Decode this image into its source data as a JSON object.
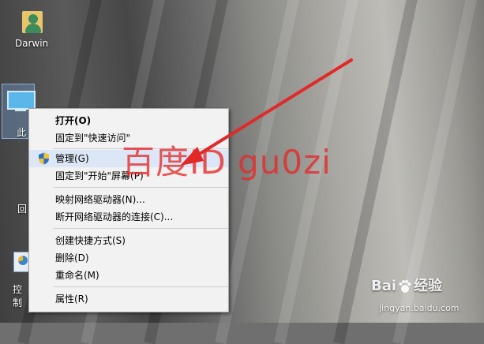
{
  "desktop": {
    "icons": [
      {
        "label": "Darwin",
        "icon": "user-folder-icon"
      },
      {
        "label": "此",
        "icon": "this-pc-icon"
      },
      {
        "label": "回",
        "icon": "recycle-bin-icon"
      },
      {
        "label": "控制",
        "icon": "control-panel-icon"
      }
    ]
  },
  "context_menu": {
    "items": [
      {
        "label": "打开(O)",
        "bold": true
      },
      {
        "label": "固定到\"快速访问\""
      },
      {
        "label": "管理(G)",
        "icon": "uac-shield-icon",
        "highlighted": true
      },
      {
        "label": "固定到\"开始\"屏幕(P)"
      },
      {
        "label": "映射网络驱动器(N)..."
      },
      {
        "label": "断开网络驱动器的连接(C)..."
      },
      {
        "label": "创建快捷方式(S)"
      },
      {
        "label": "删除(D)"
      },
      {
        "label": "重命名(M)"
      },
      {
        "label": "属性(R)"
      }
    ]
  },
  "overlay": {
    "watermark": "百度ID gu0zi",
    "arrow_color": "#e02a2a",
    "baidu_logo_left": "Bai",
    "baidu_logo_right": "经验",
    "baidu_url": "jingyan.baidu.com"
  },
  "colors": {
    "menu_background": "#f2f2f2",
    "menu_highlight": "#dbe7f6",
    "watermark": "#e62828"
  }
}
